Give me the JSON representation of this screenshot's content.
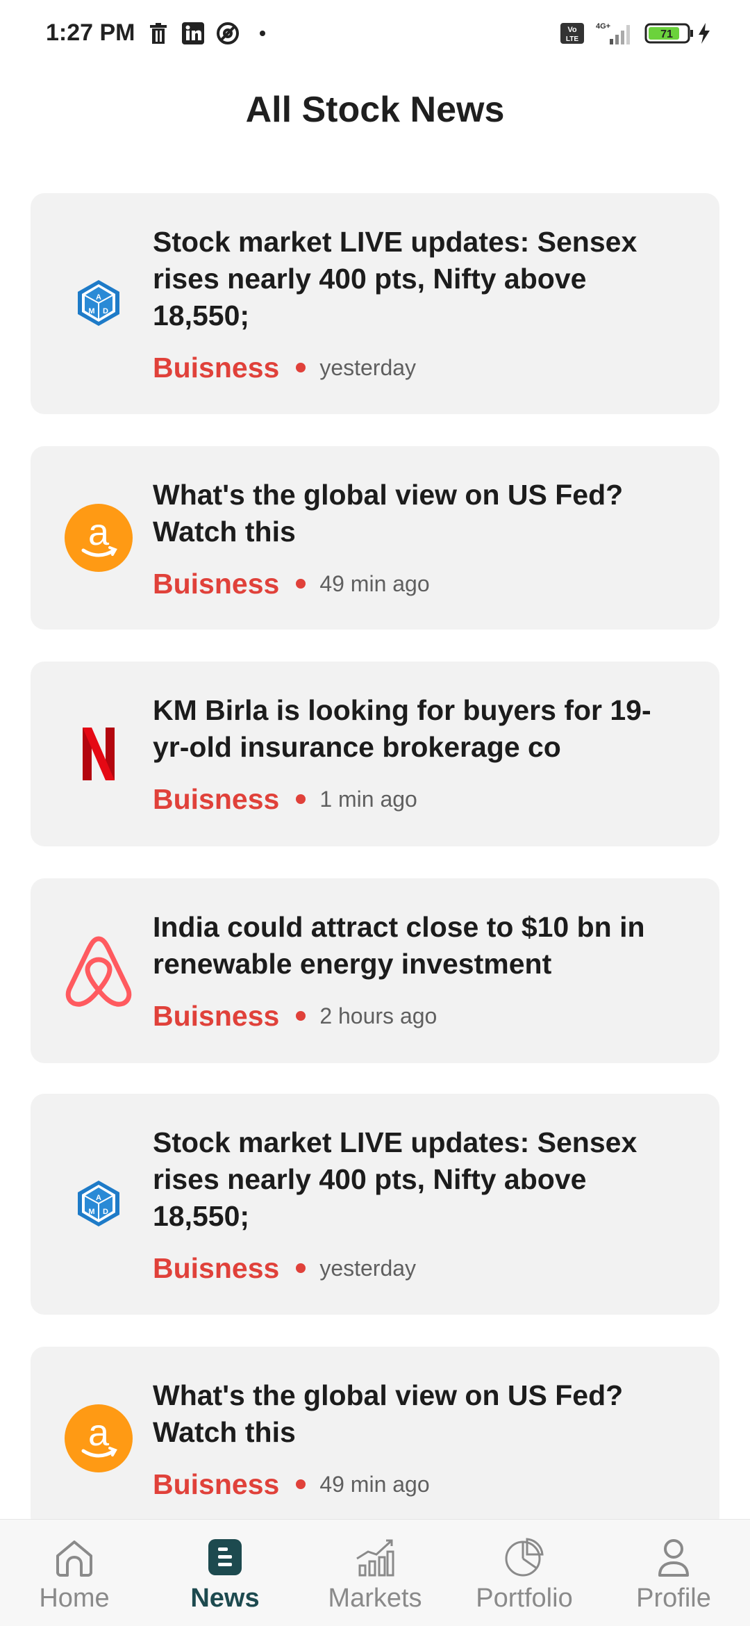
{
  "status_bar": {
    "time": "1:27 PM",
    "network": "4G+",
    "volte": "Vo LTE",
    "battery": "71"
  },
  "page": {
    "title": "All Stock News"
  },
  "news": [
    {
      "logo": "amd-logo",
      "headline": "Stock market LIVE updates: Sensex rises nearly 400 pts, Nifty above 18,550;",
      "category": "Buisness",
      "time": "yesterday"
    },
    {
      "logo": "amazon-logo",
      "headline": "What's the global view on US Fed? Watch this",
      "category": "Buisness",
      "time": "49 min ago"
    },
    {
      "logo": "netflix-logo",
      "headline": "KM Birla is looking for buyers for 19-yr-old insurance brokerage co",
      "category": "Buisness",
      "time": "1 min ago"
    },
    {
      "logo": "airbnb-logo",
      "headline": "India could attract close to $10 bn in renewable energy investment",
      "category": "Buisness",
      "time": "2 hours ago"
    },
    {
      "logo": "amd-logo",
      "headline": "Stock market LIVE updates: Sensex rises nearly 400 pts, Nifty above 18,550;",
      "category": "Buisness",
      "time": "yesterday"
    },
    {
      "logo": "amazon-logo",
      "headline": "What's the global view on US Fed? Watch this",
      "category": "Buisness",
      "time": "49 min ago"
    }
  ],
  "nav": {
    "items": [
      {
        "label": "Home",
        "icon": "home-icon"
      },
      {
        "label": "News",
        "icon": "news-icon",
        "active": true
      },
      {
        "label": "Markets",
        "icon": "markets-icon"
      },
      {
        "label": "Portfolio",
        "icon": "portfolio-icon"
      },
      {
        "label": "Profile",
        "icon": "profile-icon"
      }
    ]
  },
  "colors": {
    "accent": "#e0413a",
    "nav_active": "#1d4a4f",
    "card_bg": "#f2f2f2"
  }
}
